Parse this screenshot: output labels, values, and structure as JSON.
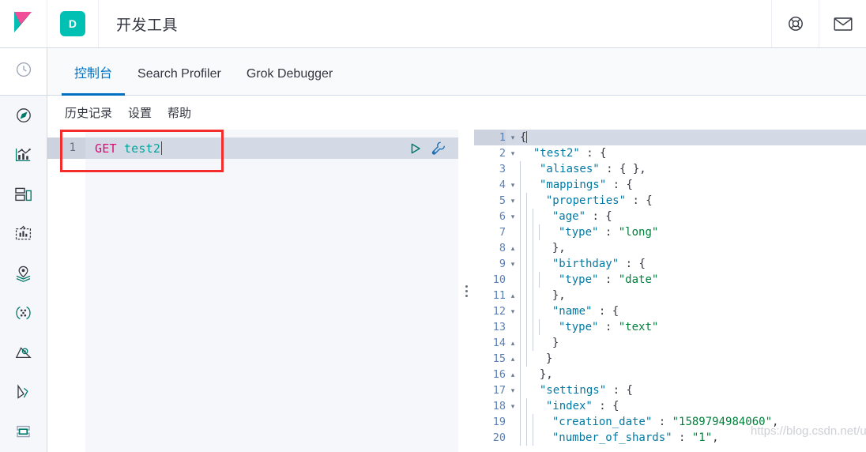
{
  "header": {
    "logo_icon": "kibana-logo",
    "app_badge_letter": "D",
    "app_title": "开发工具",
    "help_icon": "life-ring-icon",
    "mail_icon": "envelope-icon"
  },
  "sidebar": {
    "top_icon": "recently-viewed-clock-icon",
    "items": [
      {
        "icon": "compass-icon",
        "name": "discover"
      },
      {
        "icon": "bar-chart-icon",
        "name": "visualize"
      },
      {
        "icon": "dashboard-icon",
        "name": "dashboard"
      },
      {
        "icon": "canvas-icon",
        "name": "canvas"
      },
      {
        "icon": "maps-layers-icon",
        "name": "maps"
      },
      {
        "icon": "machine-learning-icon",
        "name": "machine-learning"
      },
      {
        "icon": "apm-icon",
        "name": "apm"
      },
      {
        "icon": "uptime-icon",
        "name": "uptime"
      },
      {
        "icon": "dev-tools-icon",
        "name": "dev-tools"
      }
    ]
  },
  "tabs": [
    {
      "label": "控制台",
      "active": true
    },
    {
      "label": "Search Profiler",
      "active": false
    },
    {
      "label": "Grok Debugger",
      "active": false
    }
  ],
  "subbar": [
    {
      "label": "历史记录"
    },
    {
      "label": "设置"
    },
    {
      "label": "帮助"
    }
  ],
  "editor": {
    "line_number": "1",
    "method": "GET",
    "url": "test2",
    "play_icon": "play-triangle-icon",
    "wrench_icon": "wrench-icon"
  },
  "annotation": {
    "color": "#f52c2c"
  },
  "splitter": {
    "handle_icon": "drag-handle-dots-icon"
  },
  "response": {
    "lines": [
      {
        "n": "1",
        "fold": "▾",
        "indent": 0,
        "highlight": true,
        "parts": [
          {
            "t": "pun",
            "v": "{"
          }
        ],
        "caret": true
      },
      {
        "n": "2",
        "fold": "▾",
        "indent": 0,
        "parts": [
          {
            "t": "sp",
            "v": "  "
          },
          {
            "t": "key",
            "v": "\"test2\""
          },
          {
            "t": "pun",
            "v": " : {"
          }
        ]
      },
      {
        "n": "3",
        "fold": "",
        "indent": 1,
        "parts": [
          {
            "t": "sp",
            "v": "  "
          },
          {
            "t": "key",
            "v": "\"aliases\""
          },
          {
            "t": "pun",
            "v": " : { },"
          }
        ]
      },
      {
        "n": "4",
        "fold": "▾",
        "indent": 1,
        "parts": [
          {
            "t": "sp",
            "v": "  "
          },
          {
            "t": "key",
            "v": "\"mappings\""
          },
          {
            "t": "pun",
            "v": " : {"
          }
        ]
      },
      {
        "n": "5",
        "fold": "▾",
        "indent": 2,
        "parts": [
          {
            "t": "sp",
            "v": "  "
          },
          {
            "t": "key",
            "v": "\"properties\""
          },
          {
            "t": "pun",
            "v": " : {"
          }
        ]
      },
      {
        "n": "6",
        "fold": "▾",
        "indent": 3,
        "parts": [
          {
            "t": "sp",
            "v": "  "
          },
          {
            "t": "key",
            "v": "\"age\""
          },
          {
            "t": "pun",
            "v": " : {"
          }
        ]
      },
      {
        "n": "7",
        "fold": "",
        "indent": 4,
        "parts": [
          {
            "t": "sp",
            "v": "  "
          },
          {
            "t": "key",
            "v": "\"type\""
          },
          {
            "t": "pun",
            "v": " : "
          },
          {
            "t": "str",
            "v": "\"long\""
          }
        ]
      },
      {
        "n": "8",
        "fold": "▴",
        "indent": 3,
        "parts": [
          {
            "t": "sp",
            "v": "  "
          },
          {
            "t": "pun",
            "v": "},"
          }
        ]
      },
      {
        "n": "9",
        "fold": "▾",
        "indent": 3,
        "parts": [
          {
            "t": "sp",
            "v": "  "
          },
          {
            "t": "key",
            "v": "\"birthday\""
          },
          {
            "t": "pun",
            "v": " : {"
          }
        ]
      },
      {
        "n": "10",
        "fold": "",
        "indent": 4,
        "parts": [
          {
            "t": "sp",
            "v": "  "
          },
          {
            "t": "key",
            "v": "\"type\""
          },
          {
            "t": "pun",
            "v": " : "
          },
          {
            "t": "str",
            "v": "\"date\""
          }
        ]
      },
      {
        "n": "11",
        "fold": "▴",
        "indent": 3,
        "parts": [
          {
            "t": "sp",
            "v": "  "
          },
          {
            "t": "pun",
            "v": "},"
          }
        ]
      },
      {
        "n": "12",
        "fold": "▾",
        "indent": 3,
        "parts": [
          {
            "t": "sp",
            "v": "  "
          },
          {
            "t": "key",
            "v": "\"name\""
          },
          {
            "t": "pun",
            "v": " : {"
          }
        ]
      },
      {
        "n": "13",
        "fold": "",
        "indent": 4,
        "parts": [
          {
            "t": "sp",
            "v": "  "
          },
          {
            "t": "key",
            "v": "\"type\""
          },
          {
            "t": "pun",
            "v": " : "
          },
          {
            "t": "str",
            "v": "\"text\""
          }
        ]
      },
      {
        "n": "14",
        "fold": "▴",
        "indent": 3,
        "parts": [
          {
            "t": "sp",
            "v": "  "
          },
          {
            "t": "pun",
            "v": "}"
          }
        ]
      },
      {
        "n": "15",
        "fold": "▴",
        "indent": 2,
        "parts": [
          {
            "t": "sp",
            "v": "  "
          },
          {
            "t": "pun",
            "v": "}"
          }
        ]
      },
      {
        "n": "16",
        "fold": "▴",
        "indent": 1,
        "parts": [
          {
            "t": "sp",
            "v": "  "
          },
          {
            "t": "pun",
            "v": "},"
          }
        ]
      },
      {
        "n": "17",
        "fold": "▾",
        "indent": 1,
        "parts": [
          {
            "t": "sp",
            "v": "  "
          },
          {
            "t": "key",
            "v": "\"settings\""
          },
          {
            "t": "pun",
            "v": " : {"
          }
        ]
      },
      {
        "n": "18",
        "fold": "▾",
        "indent": 2,
        "parts": [
          {
            "t": "sp",
            "v": "  "
          },
          {
            "t": "key",
            "v": "\"index\""
          },
          {
            "t": "pun",
            "v": " : {"
          }
        ]
      },
      {
        "n": "19",
        "fold": "",
        "indent": 3,
        "parts": [
          {
            "t": "sp",
            "v": "  "
          },
          {
            "t": "key",
            "v": "\"creation_date\""
          },
          {
            "t": "pun",
            "v": " : "
          },
          {
            "t": "str",
            "v": "\"1589794984060\""
          },
          {
            "t": "pun",
            "v": ","
          }
        ]
      },
      {
        "n": "20",
        "fold": "",
        "indent": 3,
        "parts": [
          {
            "t": "sp",
            "v": "  "
          },
          {
            "t": "key",
            "v": "\"number_of_shards\""
          },
          {
            "t": "pun",
            "v": " : "
          },
          {
            "t": "str",
            "v": "\"1\""
          },
          {
            "t": "pun",
            "v": ","
          }
        ]
      }
    ]
  },
  "watermark": {
    "text": "https://blog.csdn.net/u...match"
  }
}
